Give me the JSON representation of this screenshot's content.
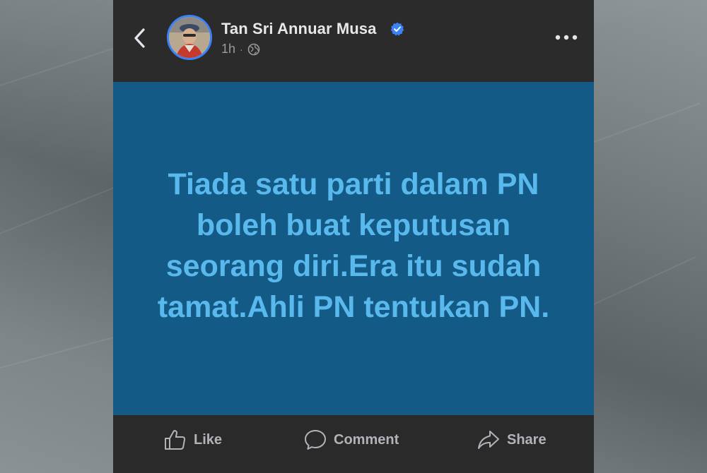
{
  "post": {
    "author_name": "Tan Sri Annuar Musa",
    "time": "1h",
    "separator": "·",
    "text": "Tiada satu parti dalam PN boleh buat keputusan seorang diri.Era itu sudah tamat.Ahli PN tentukan PN.",
    "background_color": "#135a86",
    "text_color": "#59b8ec"
  },
  "actions": {
    "like_label": "Like",
    "comment_label": "Comment",
    "share_label": "Share"
  },
  "icons": {
    "back": "chevron-left-icon",
    "verified": "verified-badge-icon",
    "privacy": "globe-icon",
    "more": "more-horizontal-icon",
    "like": "thumbs-up-icon",
    "comment": "speech-bubble-icon",
    "share": "share-arrow-icon"
  },
  "colors": {
    "accent": "#3b82f6",
    "header_bg": "#2b2b2c",
    "action_text": "#b0b3b8"
  }
}
